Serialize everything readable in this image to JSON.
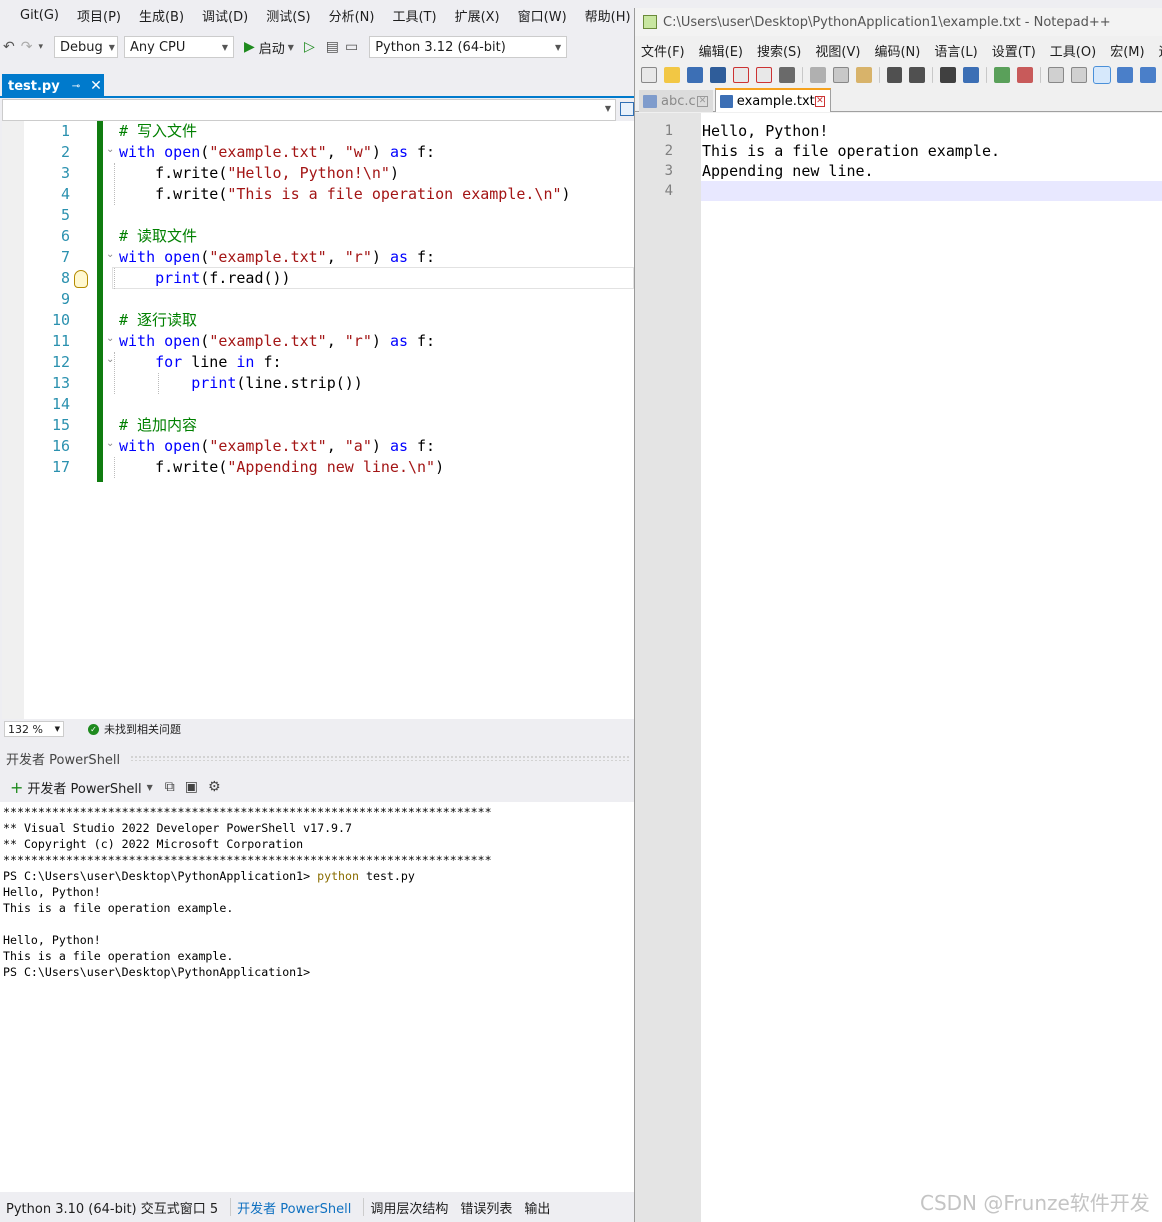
{
  "vs": {
    "menu": [
      "Git(G)",
      "项目(P)",
      "生成(B)",
      "调试(D)",
      "测试(S)",
      "分析(N)",
      "工具(T)",
      "扩展(X)",
      "窗口(W)",
      "帮助(H)"
    ],
    "toolbar": {
      "config": "Debug",
      "platform": "Any CPU",
      "start_label": "启动",
      "environment": "Python 3.12 (64-bit)"
    },
    "tab": {
      "label": "test.py",
      "pin_glyph": "⊸",
      "close_glyph": "✕"
    },
    "editor": {
      "line_numbers": [
        "1",
        "2",
        "3",
        "4",
        "5",
        "6",
        "7",
        "8",
        "9",
        "10",
        "11",
        "12",
        "13",
        "14",
        "15",
        "16",
        "17"
      ],
      "lines": [
        [
          {
            "t": "# 写入文件",
            "c": "cm"
          }
        ],
        [
          {
            "t": "with",
            "c": "kw"
          },
          {
            "t": " "
          },
          {
            "t": "open",
            "c": "kw"
          },
          {
            "t": "("
          },
          {
            "t": "\"example.txt\"",
            "c": "st"
          },
          {
            "t": ", "
          },
          {
            "t": "\"w\"",
            "c": "st"
          },
          {
            "t": ") "
          },
          {
            "t": "as",
            "c": "kw"
          },
          {
            "t": " f:"
          }
        ],
        [
          {
            "t": "    f.write("
          },
          {
            "t": "\"Hello, Python!\\n\"",
            "c": "st"
          },
          {
            "t": ")"
          }
        ],
        [
          {
            "t": "    f.write("
          },
          {
            "t": "\"This is a file operation example.\\n\"",
            "c": "st"
          },
          {
            "t": ")"
          }
        ],
        [],
        [
          {
            "t": "# 读取文件",
            "c": "cm"
          }
        ],
        [
          {
            "t": "with",
            "c": "kw"
          },
          {
            "t": " "
          },
          {
            "t": "open",
            "c": "kw"
          },
          {
            "t": "("
          },
          {
            "t": "\"example.txt\"",
            "c": "st"
          },
          {
            "t": ", "
          },
          {
            "t": "\"r\"",
            "c": "st"
          },
          {
            "t": ") "
          },
          {
            "t": "as",
            "c": "kw"
          },
          {
            "t": " f:"
          }
        ],
        [
          {
            "t": "    "
          },
          {
            "t": "print",
            "c": "kw"
          },
          {
            "t": "(f.read())"
          }
        ],
        [],
        [
          {
            "t": "# 逐行读取",
            "c": "cm"
          }
        ],
        [
          {
            "t": "with",
            "c": "kw"
          },
          {
            "t": " "
          },
          {
            "t": "open",
            "c": "kw"
          },
          {
            "t": "("
          },
          {
            "t": "\"example.txt\"",
            "c": "st"
          },
          {
            "t": ", "
          },
          {
            "t": "\"r\"",
            "c": "st"
          },
          {
            "t": ") "
          },
          {
            "t": "as",
            "c": "kw"
          },
          {
            "t": " f:"
          }
        ],
        [
          {
            "t": "    "
          },
          {
            "t": "for",
            "c": "kw"
          },
          {
            "t": " line "
          },
          {
            "t": "in",
            "c": "kw"
          },
          {
            "t": " f:"
          }
        ],
        [
          {
            "t": "        "
          },
          {
            "t": "print",
            "c": "kw"
          },
          {
            "t": "(line.strip())"
          }
        ],
        [],
        [
          {
            "t": "# 追加内容",
            "c": "cm"
          }
        ],
        [
          {
            "t": "with",
            "c": "kw"
          },
          {
            "t": " "
          },
          {
            "t": "open",
            "c": "kw"
          },
          {
            "t": "("
          },
          {
            "t": "\"example.txt\"",
            "c": "st"
          },
          {
            "t": ", "
          },
          {
            "t": "\"a\"",
            "c": "st"
          },
          {
            "t": ") "
          },
          {
            "t": "as",
            "c": "kw"
          },
          {
            "t": " f:"
          }
        ],
        [
          {
            "t": "    f.write("
          },
          {
            "t": "\"Appending new line.\\n\"",
            "c": "st"
          },
          {
            "t": ")"
          }
        ]
      ],
      "current_line": 8
    },
    "status": {
      "zoom": "132 %",
      "issues": "未找到相关问题"
    },
    "powershell": {
      "panel_title": "开发者 PowerShell",
      "new_label": "开发者 PowerShell",
      "console_lines": [
        "**********************************************************************",
        "** Visual Studio 2022 Developer PowerShell v17.9.7",
        "** Copyright (c) 2022 Microsoft Corporation",
        "**********************************************************************",
        "PS C:\\Users\\user\\Desktop\\PythonApplication1> ",
        "Hello, Python!",
        "This is a file operation example.",
        "",
        "Hello, Python!",
        "This is a file operation example.",
        "PS C:\\Users\\user\\Desktop\\PythonApplication1>"
      ],
      "command": "python",
      "command_arg": " test.py"
    },
    "bottom_tabs": [
      "Python 3.10 (64-bit) 交互式窗口 5",
      "开发者 PowerShell",
      "调用层次结构",
      "错误列表",
      "输出"
    ],
    "bottom_active": 1
  },
  "npp": {
    "title": "C:\\Users\\user\\Desktop\\PythonApplication1\\example.txt - Notepad++",
    "menu": [
      "文件(F)",
      "编辑(E)",
      "搜索(S)",
      "视图(V)",
      "编码(N)",
      "语言(L)",
      "设置(T)",
      "工具(O)",
      "宏(M)",
      "运行"
    ],
    "tabs": [
      {
        "label": "abc.c",
        "active": false
      },
      {
        "label": "example.txt",
        "active": true
      }
    ],
    "line_numbers": [
      "1",
      "2",
      "3",
      "4"
    ],
    "lines": [
      "Hello, Python!",
      "This is a file operation example.",
      "Appending new line.",
      ""
    ],
    "current_line": 4
  },
  "watermark": "CSDN @Frunze软件开发",
  "colors": {
    "vs_accent": "#007acc",
    "keyword": "#0000ff",
    "string": "#a31515",
    "comment": "#008000",
    "change_bar": "#107c10",
    "npp_tab_accent": "#f6a21e"
  }
}
